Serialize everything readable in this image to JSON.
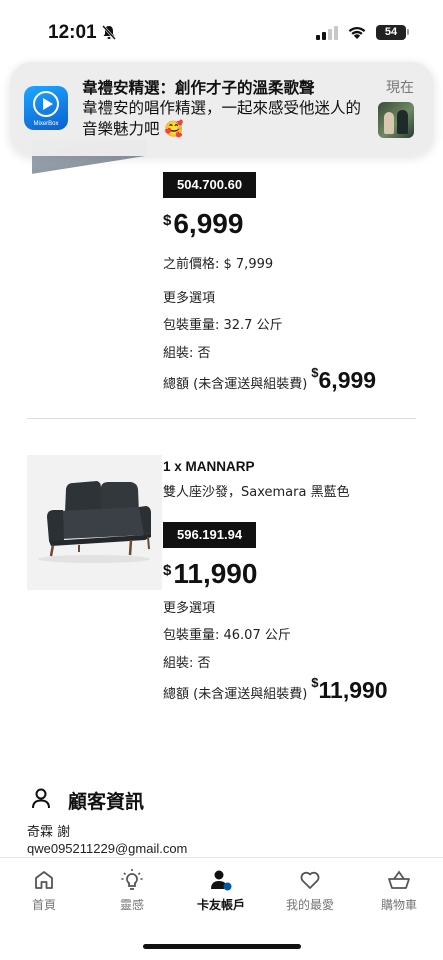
{
  "status_bar": {
    "time": "12:01",
    "battery": "54"
  },
  "notification": {
    "app_name": "MixerBox",
    "title": "韋禮安精選：創作才子的溫柔歌聲",
    "body": "韋禮安的唱作精選，一起來感受他迷人的音樂魅力吧 🥰",
    "time": "現在"
  },
  "products": [
    {
      "article_number": "504.700.60",
      "currency": "$",
      "price": "6,999",
      "previous_price": "之前價格: $ 7,999",
      "more_options": "更多選項",
      "package_weight": "包裝重量: 32.7 公斤",
      "assembly": "組裝: 否",
      "total_label": "總額 (未含運送與組裝費)",
      "total_currency": "$",
      "total": "6,999"
    },
    {
      "name": "1 x MANNARP",
      "description": "雙人座沙發，Saxemara 黑藍色",
      "article_number": "596.191.94",
      "currency": "$",
      "price": "11,990",
      "more_options": "更多選項",
      "package_weight": "包裝重量: 46.07 公斤",
      "assembly": "組裝: 否",
      "total_label": "總額 (未含運送與組裝費)",
      "total_currency": "$",
      "total": "11,990"
    }
  ],
  "customer": {
    "heading": "顧客資訊",
    "name": "奇霖 謝",
    "email": "qwe095211229@gmail.com"
  },
  "bottom_nav": {
    "items": [
      {
        "label": "首頁",
        "icon": "home-icon"
      },
      {
        "label": "靈感",
        "icon": "lightbulb-icon"
      },
      {
        "label": "卡友帳戶",
        "icon": "account-icon",
        "active": true
      },
      {
        "label": "我的最愛",
        "icon": "heart-icon"
      },
      {
        "label": "購物車",
        "icon": "cart-icon"
      }
    ]
  }
}
